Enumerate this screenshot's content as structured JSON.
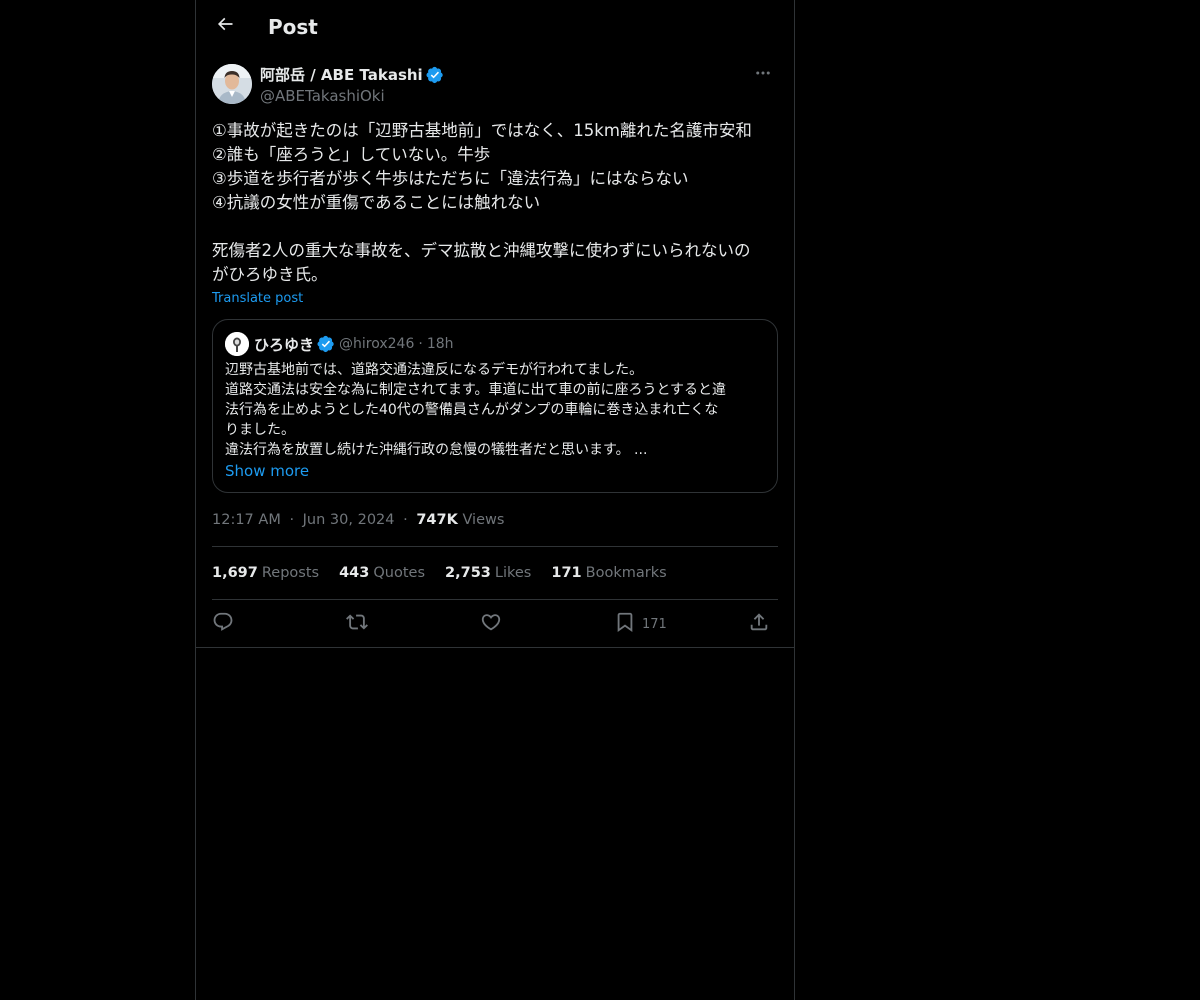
{
  "header": {
    "title": "Post"
  },
  "author": {
    "display_name": "阿部岳 / ABE Takashi",
    "handle": "@ABETakashiOki",
    "verified": true
  },
  "post": {
    "lines": [
      "①事故が起きたのは「辺野古基地前」ではなく、15km離れた名護市安和",
      "②誰も「座ろうと」していない。牛歩",
      "③歩道を歩行者が歩く牛歩はただちに「違法行為」にはならない",
      "④抗議の女性が重傷であることには触れない",
      "",
      "死傷者2人の重大な事故を、デマ拡散と沖縄攻撃に使わずにいられないの",
      "がひろゆき氏。"
    ],
    "translate_label": "Translate post"
  },
  "quote": {
    "display_name": "ひろゆき",
    "handle": "@hirox246",
    "separator": "·",
    "time": "18h",
    "lines": [
      "辺野古基地前では、道路交通法違反になるデモが行われてました。",
      "道路交通法は安全な為に制定されてます。車道に出て車の前に座ろうとすると違",
      "法行為を止めようとした40代の警備員さんがダンプの車輪に巻き込まれ亡くな",
      "りました。",
      "違法行為を放置し続けた沖縄行政の怠慢の犠牲者だと思います。 ..."
    ],
    "show_more": "Show more"
  },
  "meta": {
    "time": "12:17 AM",
    "date": "Jun 30, 2024",
    "separator": "·",
    "views_count": "747K",
    "views_label": "Views"
  },
  "stats": [
    {
      "count": "1,697",
      "label": "Reposts"
    },
    {
      "count": "443",
      "label": "Quotes"
    },
    {
      "count": "2,753",
      "label": "Likes"
    },
    {
      "count": "171",
      "label": "Bookmarks"
    }
  ],
  "actions": {
    "reply_icon": "reply-icon",
    "repost_icon": "repost-icon",
    "like_icon": "like-icon",
    "bookmark_icon": "bookmark-icon",
    "bookmark_count": "171",
    "share_icon": "share-icon"
  },
  "colors": {
    "background": "#000000",
    "text": "#e7e9ea",
    "secondary": "#71767b",
    "accent": "#1d9bf0",
    "border": "#2f3336"
  }
}
